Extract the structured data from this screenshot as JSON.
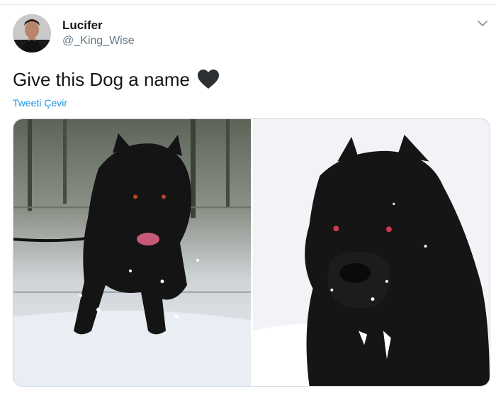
{
  "tweet": {
    "display_name": "Lucifer",
    "handle": "@_King_Wise",
    "text": "Give this Dog a name",
    "translate_label": "Tweeti Çevir"
  },
  "icons": {
    "caret": "chevron-down-icon",
    "heart": "black-heart-emoji"
  },
  "colors": {
    "link": "#1b95e0",
    "handle": "#657786",
    "text": "#14171a"
  }
}
